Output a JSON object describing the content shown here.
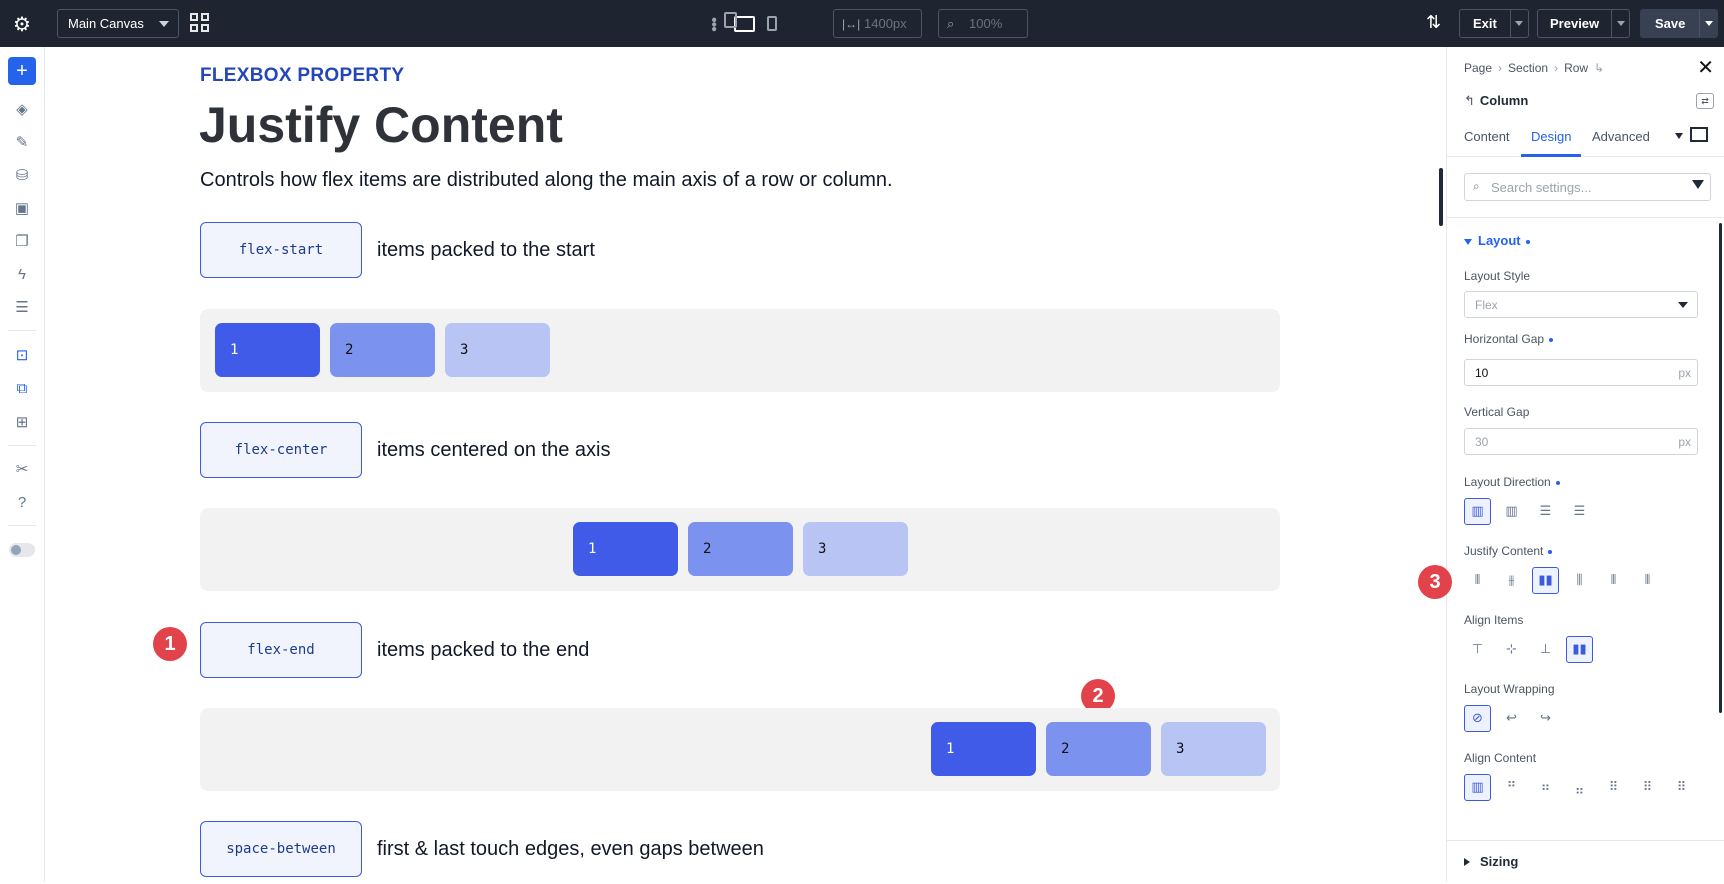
{
  "topbar": {
    "canvas_selector": "Main Canvas",
    "width_value": "1400px",
    "zoom_value": "100%",
    "exit_label": "Exit",
    "preview_label": "Preview",
    "save_label": "Save"
  },
  "canvas": {
    "eyebrow": "FLEXBOX PROPERTY",
    "title": "Justify Content",
    "description": "Controls how flex items are distributed along the main axis of a row or column.",
    "examples": [
      {
        "value": "flex-start",
        "caption": "items packed to the start",
        "items": [
          "1",
          "2",
          "3"
        ]
      },
      {
        "value": "flex-center",
        "caption": "items centered on the axis",
        "items": [
          "1",
          "2",
          "3"
        ]
      },
      {
        "value": "flex-end",
        "caption": "items packed to the end",
        "items": [
          "1",
          "2",
          "3"
        ]
      },
      {
        "value": "space-between",
        "caption": "first & last touch edges, even gaps between"
      }
    ],
    "markers": [
      "1",
      "2",
      "3"
    ]
  },
  "panel": {
    "breadcrumb": [
      "Page",
      "Section",
      "Row"
    ],
    "element_title": "Column",
    "tabs": [
      "Content",
      "Design",
      "Advanced"
    ],
    "active_tab": "Design",
    "search_placeholder": "Search settings...",
    "section_title": "Layout",
    "layout_style_label": "Layout Style",
    "layout_style_value": "Flex",
    "horizontal_gap_label": "Horizontal Gap",
    "horizontal_gap_value": "10",
    "horizontal_gap_unit": "px",
    "vertical_gap_label": "Vertical Gap",
    "vertical_gap_value": "30",
    "vertical_gap_unit": "px",
    "layout_direction_label": "Layout Direction",
    "justify_content_label": "Justify Content",
    "align_items_label": "Align Items",
    "layout_wrapping_label": "Layout Wrapping",
    "align_content_label": "Align Content",
    "sizing_label": "Sizing"
  },
  "colors": {
    "accent": "#2563eb",
    "item1": "#3f5be8",
    "item2": "#7b93ee",
    "item3": "#b7c4f4",
    "marker": "#e2434b",
    "topbar": "#1e2530"
  }
}
